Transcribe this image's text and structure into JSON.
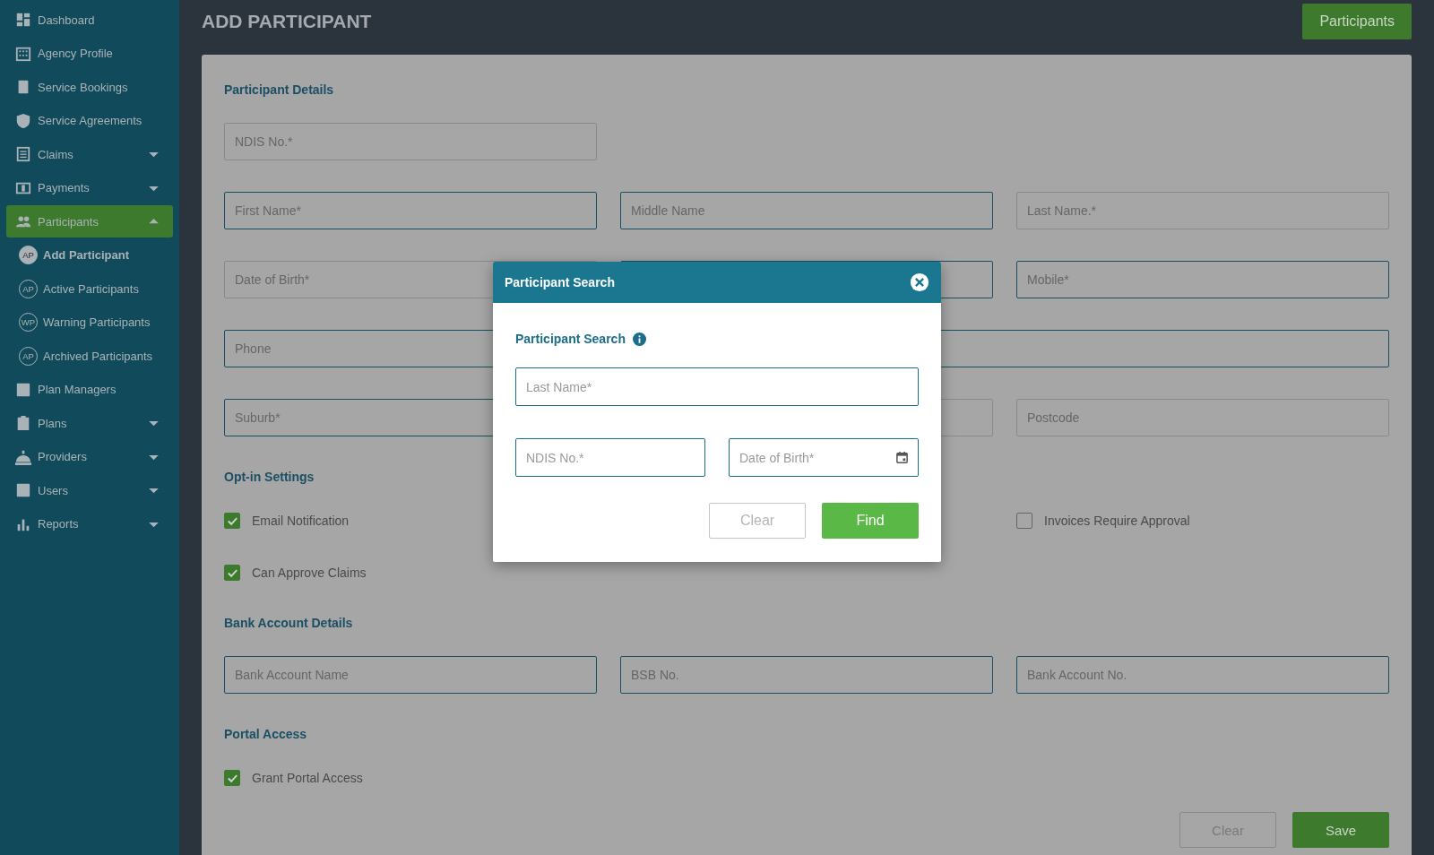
{
  "sidebar": {
    "items": [
      {
        "label": "Dashboard",
        "selected": false
      },
      {
        "label": "Agency Profile",
        "selected": false
      },
      {
        "label": "Service Bookings",
        "selected": false
      },
      {
        "label": "Service Agreements",
        "selected": false
      },
      {
        "label": "Claims",
        "expanded": false,
        "selected": false
      },
      {
        "label": "Payments",
        "expanded": false,
        "selected": false
      },
      {
        "label": "Participants",
        "expanded": true,
        "selected": true,
        "children": [
          {
            "badge": "AP",
            "label": "Add Participant",
            "selected": true
          },
          {
            "badge": "AP",
            "label": "Active Participants",
            "selected": false
          },
          {
            "badge": "WP",
            "label": "Warning Participants",
            "selected": false
          },
          {
            "badge": "AP",
            "label": "Archived Participants",
            "selected": false
          }
        ]
      },
      {
        "label": "Plan Managers",
        "selected": false
      },
      {
        "label": "Plans",
        "expanded": false,
        "selected": false
      },
      {
        "label": "Providers",
        "expanded": false,
        "selected": false
      },
      {
        "label": "Users",
        "expanded": false,
        "selected": false
      },
      {
        "label": "Reports",
        "expanded": false,
        "selected": false
      }
    ]
  },
  "header": {
    "title": "ADD PARTICIPANT",
    "button": "Participants"
  },
  "sections": [
    {
      "heading": "Participant Details",
      "rows": [
        {
          "kind": "fields",
          "items": [
            {
              "placeholder": "NDIS No.*",
              "accent": false
            }
          ]
        },
        {
          "kind": "fields",
          "items": [
            {
              "placeholder": "First Name*",
              "accent": true
            },
            {
              "placeholder": "Middle Name",
              "accent": true
            },
            {
              "placeholder": "Last Name.*",
              "accent": false
            }
          ]
        },
        {
          "kind": "fields",
          "items": [
            {
              "placeholder": "Date of Birth*",
              "accent": false
            },
            {
              "accent": true
            },
            {
              "placeholder": "Mobile*",
              "accent": true
            }
          ]
        },
        {
          "kind": "fields",
          "items": [
            {
              "placeholder": "Phone",
              "accent": true
            },
            {
              "accent": true,
              "wide": true
            }
          ]
        },
        {
          "kind": "fields",
          "items": [
            {
              "placeholder": "Suburb*",
              "accent": true
            },
            {
              "accent": false
            },
            {
              "placeholder": "Postcode",
              "accent": false
            }
          ]
        }
      ]
    },
    {
      "heading": "Opt-in Settings",
      "rows": [
        {
          "kind": "checks",
          "items": [
            {
              "label": "Email Notification",
              "checked": true
            },
            {
              "label": "Invoices Require Approval",
              "checked": false
            }
          ]
        },
        {
          "kind": "checks",
          "items": [
            {
              "label": "Can Approve Claims",
              "checked": true
            }
          ]
        }
      ]
    },
    {
      "heading": "Bank Account Details",
      "rows": [
        {
          "kind": "fields",
          "items": [
            {
              "placeholder": "Bank Account Name",
              "accent": true
            },
            {
              "placeholder": "BSB No.",
              "accent": true
            },
            {
              "placeholder": "Bank Account No.",
              "accent": true
            }
          ]
        }
      ]
    },
    {
      "heading": "Portal Access",
      "rows": [
        {
          "kind": "checks",
          "items": [
            {
              "label": "Grant Portal Access",
              "checked": true
            }
          ]
        }
      ]
    }
  ],
  "form_buttons": [
    {
      "label": "Clear",
      "kind": "secondary"
    },
    {
      "label": "Save",
      "kind": "primary"
    }
  ],
  "modal": {
    "title": "Participant Search",
    "heading": "Participant Search",
    "fields": [
      {
        "placeholder": "Last Name*",
        "kind": "text"
      },
      {
        "placeholder": "NDIS No.*",
        "kind": "text"
      },
      {
        "placeholder": "Date of Birth*",
        "kind": "date"
      }
    ],
    "buttons": [
      {
        "label": "Clear",
        "kind": "secondary"
      },
      {
        "label": "Find",
        "kind": "primary"
      }
    ]
  }
}
